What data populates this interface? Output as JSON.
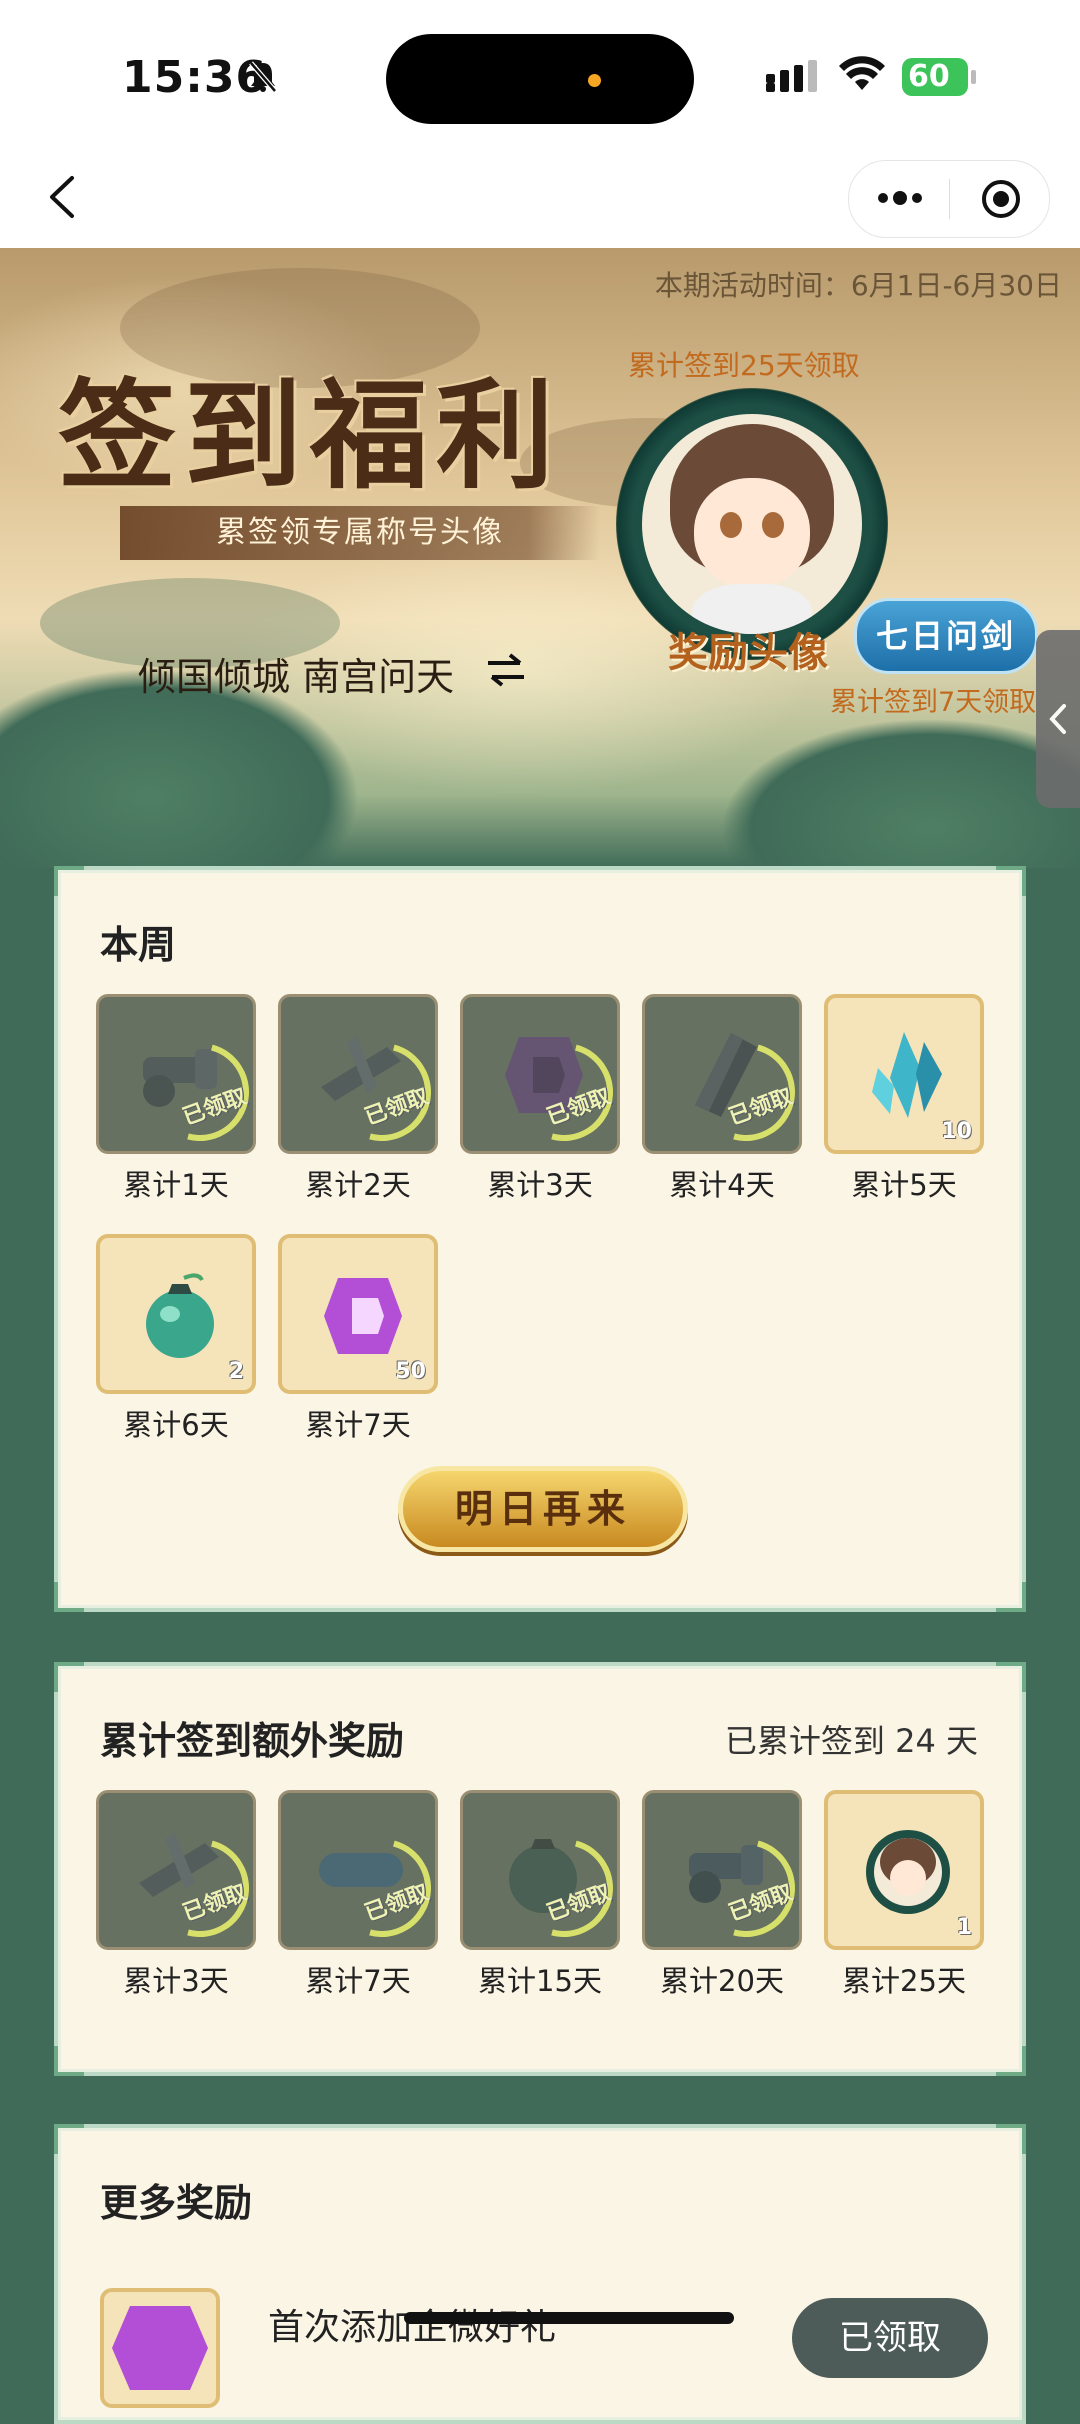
{
  "status_bar": {
    "time": "15:36",
    "battery": "60"
  },
  "hero": {
    "period": "本期活动时间：6月1日-6月30日",
    "title": "签到福利",
    "subtitle": "累签领专属称号头像",
    "player_name": "倾国倾城 南宫问天",
    "avatar_note": "累计签到25天领取",
    "avatar_label": "奖励头像",
    "title_badge": "七日问剑",
    "badge_note": "累计签到7天领取"
  },
  "week_panel": {
    "title": "本周",
    "claimed_text": "已领取",
    "items": [
      {
        "label": "累计1天",
        "icon": "cannon-icon",
        "claimed": true,
        "count": ""
      },
      {
        "label": "累计2天",
        "icon": "crossbow-icon",
        "claimed": true,
        "count": ""
      },
      {
        "label": "累计3天",
        "icon": "purple-token-icon",
        "claimed": true,
        "count": ""
      },
      {
        "label": "累计4天",
        "icon": "whetstone-icon",
        "claimed": true,
        "count": ""
      },
      {
        "label": "累计5天",
        "icon": "crystal-icon",
        "claimed": false,
        "count": "10"
      },
      {
        "label": "累计6天",
        "icon": "jade-pouch-icon",
        "claimed": false,
        "count": "2"
      },
      {
        "label": "累计7天",
        "icon": "purple-token-icon",
        "claimed": false,
        "count": "50"
      }
    ],
    "button_label": "明日再来"
  },
  "cumulative_panel": {
    "title": "累计签到额外奖励",
    "progress_text": "已累计签到 24 天",
    "items": [
      {
        "label": "累计3天",
        "icon": "crossbow-icon",
        "claimed": true,
        "count": ""
      },
      {
        "label": "累计7天",
        "icon": "title-badge-icon",
        "claimed": true,
        "count": ""
      },
      {
        "label": "累计15天",
        "icon": "jade-pouch-icon",
        "claimed": true,
        "count": ""
      },
      {
        "label": "累计20天",
        "icon": "cannon-icon",
        "claimed": true,
        "count": ""
      },
      {
        "label": "累计25天",
        "icon": "avatar-frame-icon",
        "claimed": false,
        "count": "1"
      }
    ]
  },
  "more_panel": {
    "title": "更多奖励",
    "reward_text": "首次添加企微好礼",
    "reward_button": "已领取"
  },
  "colors": {
    "accent_gold": "#dfbd74",
    "panel_bg": "#fbf5e5",
    "page_green": "#3f6b58",
    "badge_blue": "#1d6fa8"
  }
}
